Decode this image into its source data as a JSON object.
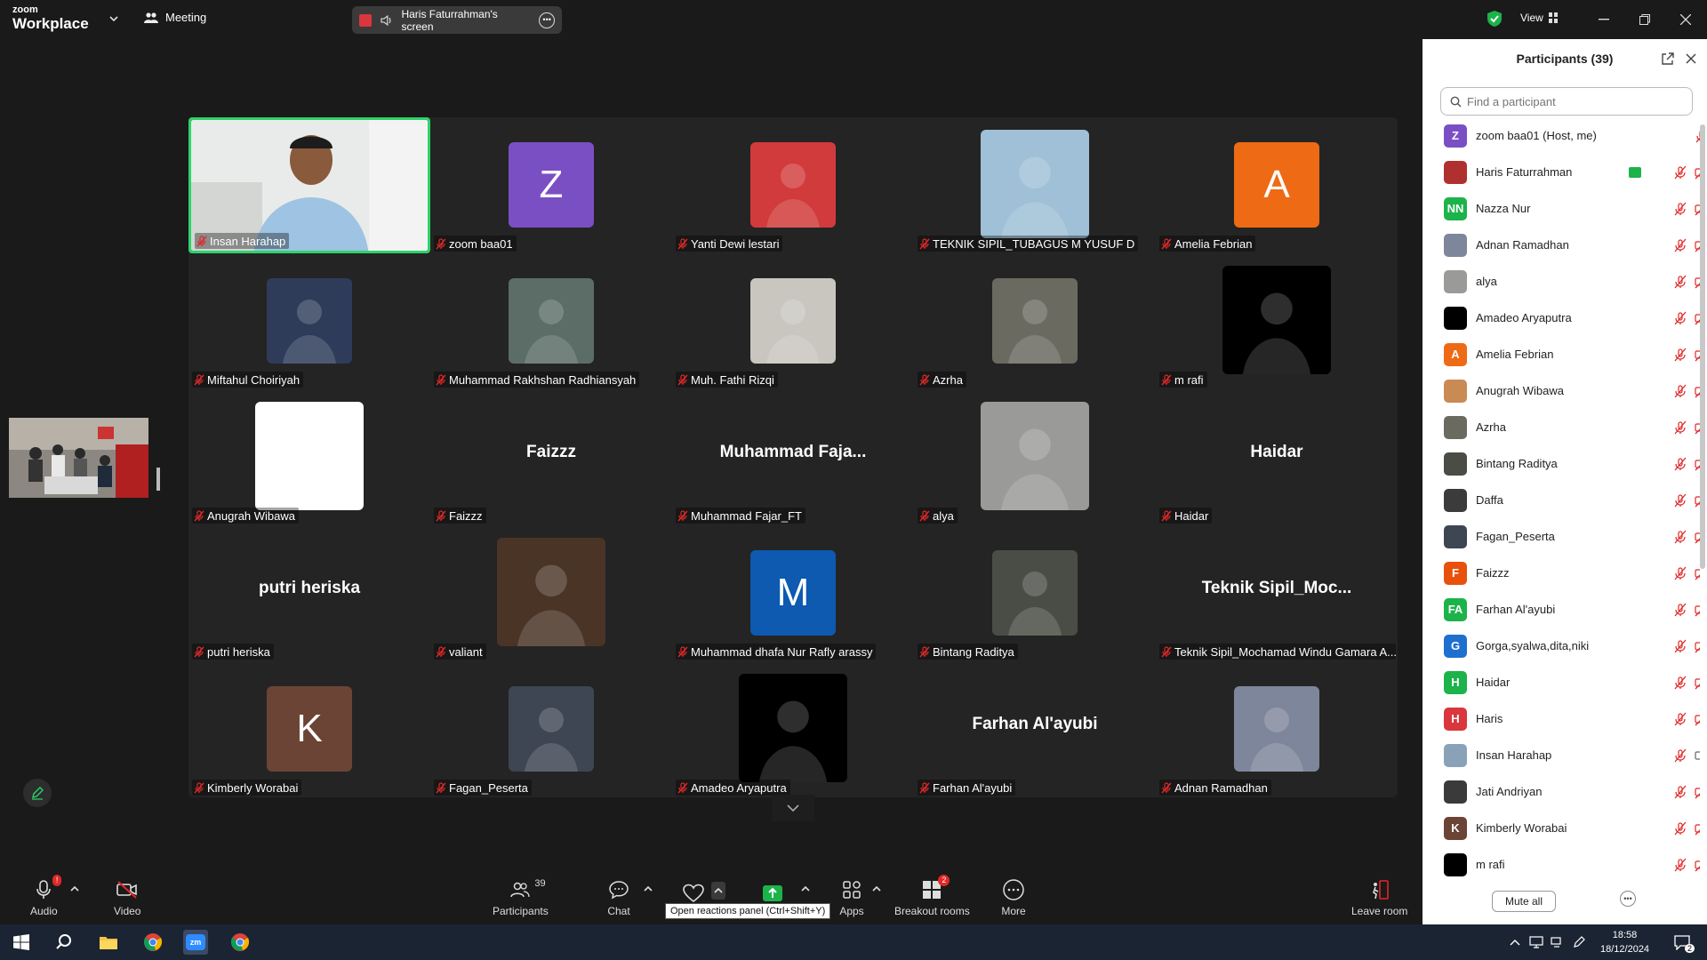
{
  "app": {
    "brand_small": "zoom",
    "brand_big": "Workplace",
    "meeting_label": "Meeting",
    "view_label": "View"
  },
  "share": {
    "label": "Haris Faturrahman's screen"
  },
  "gallery": {
    "tiles": [
      {
        "name": "Insan Harahap",
        "kind": "video",
        "active": true
      },
      {
        "name": "zoom baa01",
        "kind": "letter",
        "letter": "Z",
        "color": "#7b4fc4"
      },
      {
        "name": "Yanti Dewi lestari",
        "kind": "photo",
        "color": "#d23b3b"
      },
      {
        "name": "TEKNIK SIPIL_TUBAGUS M YUSUF D",
        "kind": "photo-lg",
        "color": "#9fc0d6"
      },
      {
        "name": "Amelia Febrian",
        "kind": "letter",
        "letter": "A",
        "color": "#ee6a14"
      },
      {
        "name": "Miftahul Choiriyah",
        "kind": "photo",
        "color": "#2e3c5a"
      },
      {
        "name": "Muhammad Rakhshan Radhiansyah",
        "kind": "photo",
        "color": "#5b6d66"
      },
      {
        "name": "Muh. Fathi Rizqi",
        "kind": "photo",
        "color": "#c9c6c0"
      },
      {
        "name": "Azrha",
        "kind": "photo",
        "color": "#6b6a61"
      },
      {
        "name": "m rafi",
        "kind": "photo-lg",
        "color": "#000000"
      },
      {
        "name": "Anugrah Wibawa",
        "kind": "photo-lg",
        "color": "#ffffff"
      },
      {
        "name": "Faizzz",
        "kind": "text",
        "display": "Faizzz"
      },
      {
        "name": "Muhammad Fajar_FT",
        "kind": "text",
        "display": "Muhammad  Faja..."
      },
      {
        "name": "alya",
        "kind": "photo-lg",
        "color": "#9a9b98"
      },
      {
        "name": "Haidar",
        "kind": "text",
        "display": "Haidar"
      },
      {
        "name": "putri heriska",
        "kind": "text",
        "display": "putri heriska"
      },
      {
        "name": "valiant",
        "kind": "photo-lg",
        "color": "#4a3426"
      },
      {
        "name": "Muhammad dhafa Nur Rafly arassy",
        "kind": "letter",
        "letter": "M",
        "color": "#0d5ab0"
      },
      {
        "name": "Bintang Raditya",
        "kind": "photo",
        "color": "#4a4d46"
      },
      {
        "name": "Teknik Sipil_Mochamad Windu Gamara A...",
        "kind": "text",
        "display": "Teknik  Sipil_Moc..."
      },
      {
        "name": "Kimberly Worabai",
        "kind": "letter",
        "letter": "K",
        "color": "#6b4436"
      },
      {
        "name": "Fagan_Peserta",
        "kind": "photo",
        "color": "#3e4553"
      },
      {
        "name": "Amadeo Aryaputra",
        "kind": "photo-lg",
        "color": "#000000"
      },
      {
        "name": "Farhan Al'ayubi",
        "kind": "text",
        "display": "Farhan Al'ayubi"
      },
      {
        "name": "Adnan Ramadhan",
        "kind": "photo",
        "color": "#7e869c"
      }
    ]
  },
  "toolbar": {
    "audio": "Audio",
    "video": "Video",
    "participants": "Participants",
    "participants_count": "39",
    "chat": "Chat",
    "apps": "Apps",
    "breakout": "Breakout rooms",
    "breakout_badge": "2",
    "more": "More",
    "leave": "Leave room",
    "tooltip": "Open reactions panel (Ctrl+Shift+Y)"
  },
  "panel": {
    "title": "Participants (39)",
    "search_placeholder": "Find a participant",
    "mute_all": "Mute all",
    "participants": [
      {
        "name": "zoom baa01 (Host, me)",
        "avatar": "Z",
        "color": "#7b4fc4",
        "cam": false
      },
      {
        "name": "Haris Faturrahman",
        "avatar": "",
        "color": "#b03030",
        "share": true
      },
      {
        "name": " Nazza Nur",
        "avatar": "NN",
        "color": "#1cb34a"
      },
      {
        "name": "Adnan Ramadhan",
        "avatar": "",
        "color": "#7e869c"
      },
      {
        "name": "alya",
        "avatar": "",
        "color": "#9a9b98"
      },
      {
        "name": "Amadeo Aryaputra",
        "avatar": "",
        "color": "#000000"
      },
      {
        "name": "Amelia Febrian",
        "avatar": "A",
        "color": "#ee6a14"
      },
      {
        "name": "Anugrah Wibawa",
        "avatar": "",
        "color": "#c98a54"
      },
      {
        "name": "Azrha",
        "avatar": "",
        "color": "#6b6a61"
      },
      {
        "name": "Bintang Raditya",
        "avatar": "",
        "color": "#4a4d46"
      },
      {
        "name": "Daffa",
        "avatar": "",
        "color": "#3b3b3b"
      },
      {
        "name": "Fagan_Peserta",
        "avatar": "",
        "color": "#3e4553"
      },
      {
        "name": "Faizzz",
        "avatar": "F",
        "color": "#e8510c"
      },
      {
        "name": "Farhan Al'ayubi",
        "avatar": "FA",
        "color": "#1cb34a"
      },
      {
        "name": "Gorga,syalwa,dita,niki",
        "avatar": "G",
        "color": "#1f6fd0"
      },
      {
        "name": "Haidar",
        "avatar": "H",
        "color": "#1cb34a"
      },
      {
        "name": "Haris",
        "avatar": "H",
        "color": "#d9363e"
      },
      {
        "name": "Insan Harahap",
        "avatar": "",
        "color": "#8aa2b8",
        "video": true
      },
      {
        "name": "Jati Andriyan",
        "avatar": "",
        "color": "#3a3a3a"
      },
      {
        "name": "Kimberly Worabai",
        "avatar": "K",
        "color": "#6b4436"
      },
      {
        "name": "m rafi",
        "avatar": "",
        "color": "#000000"
      }
    ]
  },
  "taskbar": {
    "time": "18:58",
    "date": "18/12/2024",
    "notif": "2",
    "zoom_label": "zm"
  }
}
